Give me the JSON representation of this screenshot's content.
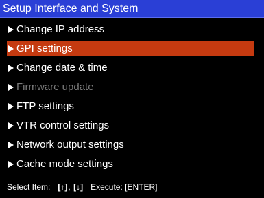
{
  "title": "Setup Interface and System",
  "menu": {
    "items": [
      {
        "label": "Change IP address",
        "state": "normal"
      },
      {
        "label": "GPI settings",
        "state": "selected"
      },
      {
        "label": "Change date & time",
        "state": "normal"
      },
      {
        "label": "Firmware update",
        "state": "disabled"
      },
      {
        "label": "FTP settings",
        "state": "normal"
      },
      {
        "label": "VTR control settings",
        "state": "normal"
      },
      {
        "label": "Network output settings",
        "state": "normal"
      },
      {
        "label": "Cache mode settings",
        "state": "normal"
      }
    ]
  },
  "footer": {
    "select_label": "Select Item:",
    "key_up": "[↑]",
    "separator": ",",
    "key_down": "[↓]",
    "execute_label": "Execute:",
    "key_enter": "[ENTER]"
  },
  "colors": {
    "background": "#000000",
    "title_bar": "#2a3fd6",
    "selection": "#c53a10",
    "disabled_text": "#7a7a7a"
  }
}
